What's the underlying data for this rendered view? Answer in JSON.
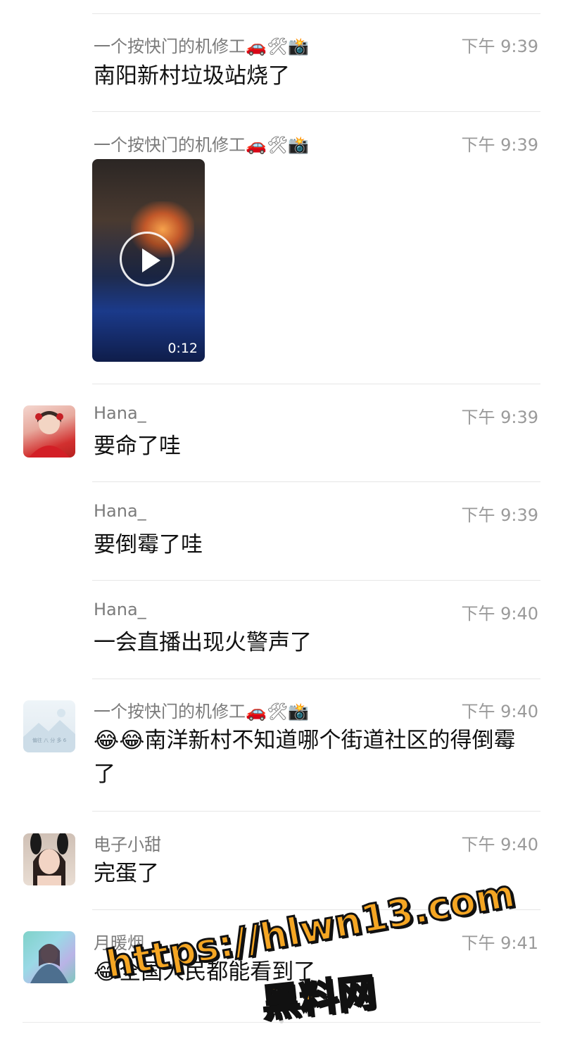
{
  "messages": [
    {
      "name": "一个按快门的机修工🚗🛠📸",
      "time": "下午 9:39",
      "text": "南阳新村垃圾站烧了"
    },
    {
      "name": "一个按快门的机修工🚗🛠📸",
      "time": "下午 9:39",
      "video_duration": "0:12"
    },
    {
      "name": "Hana_",
      "time": "下午 9:39",
      "text": "要命了哇"
    },
    {
      "name": "Hana_",
      "time": "下午 9:39",
      "text": "要倒霉了哇"
    },
    {
      "name": "Hana_",
      "time": "下午 9:40",
      "text": "一会直播出现火警声了"
    },
    {
      "name": "一个按快门的机修工🚗🛠📸",
      "time": "下午 9:40",
      "text": "😂😂南洋新村不知道哪个街道社区的得倒霉了"
    },
    {
      "name": "电子小甜",
      "time": "下午 9:40",
      "text": "完蛋了"
    },
    {
      "name": "月暖烟",
      "time": "下午 9:41",
      "text": "😂全国人民都能看到了"
    }
  ],
  "avatars": {
    "placeholder_caption": "偏往 八 分 多 6"
  },
  "watermark": {
    "line1": "https://hlwn13.com",
    "line2": "黑料网"
  }
}
